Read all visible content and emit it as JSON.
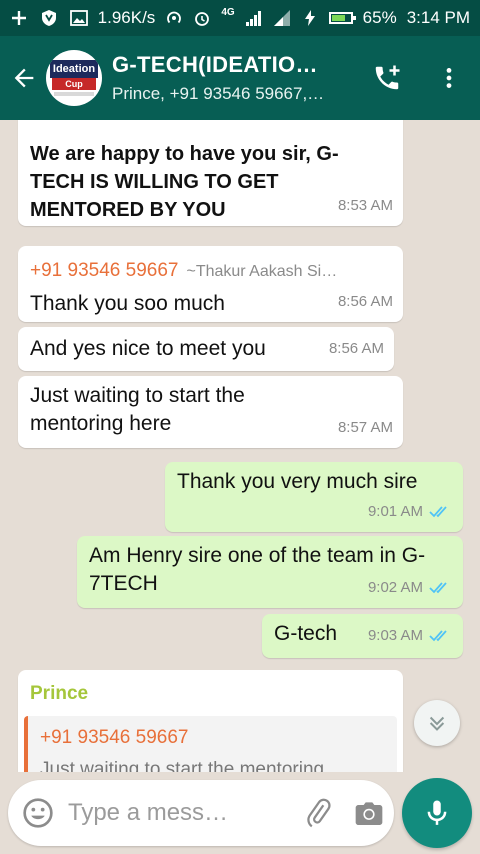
{
  "status_bar": {
    "net_speed": "1.96K/s",
    "network": "4G",
    "battery": "65%",
    "battery_level": 0.65,
    "time": "3:14 PM"
  },
  "header": {
    "avatar_text_top": "Ideation",
    "avatar_text_bottom": "Cup",
    "title": "G-TECH(IDEATIO…",
    "subtitle": "Prince, +91 93546 59667,…",
    "icons": [
      "back-arrow",
      "add-call",
      "more-vert"
    ]
  },
  "messages": [
    {
      "direction": "incoming",
      "bold": true,
      "text": "We are happy to have you sir, G-TECH IS WILLING TO GET MENTORED BY YOU",
      "time": "8:53 AM"
    },
    {
      "direction": "incoming",
      "sender": "+91 93546 59667",
      "sender_alias": "~Thakur Aakash Si…",
      "text": "Thank you soo much",
      "time": "8:56 AM"
    },
    {
      "direction": "incoming",
      "text": "And yes nice to meet you",
      "time": "8:56 AM"
    },
    {
      "direction": "incoming",
      "text": "Just waiting to start the mentoring here",
      "time": "8:57 AM"
    },
    {
      "direction": "outgoing",
      "text": "Thank you very much sire",
      "time": "9:01 AM",
      "status": "read"
    },
    {
      "direction": "outgoing",
      "text": "Am Henry sire one of the team in G-7TECH",
      "time": "9:02 AM",
      "status": "read"
    },
    {
      "direction": "outgoing",
      "text": "G-tech",
      "time": "9:03 AM",
      "status": "read"
    },
    {
      "direction": "incoming",
      "sender": "Prince",
      "quote_sender": "+91 93546 59667",
      "quote_text": "Just waiting to start the mentoring"
    }
  ],
  "composer": {
    "placeholder": "Type a mess…"
  },
  "colors": {
    "toolbar": "#075e54",
    "statusbar": "#054d44",
    "outgoing_bubble": "#dcf8c6",
    "incoming_bubble": "#ffffff",
    "sender_orange": "#e8703a",
    "sender_green": "#a5c63b",
    "read_ticks": "#4fc3f7",
    "mic_button": "#128c7e"
  }
}
